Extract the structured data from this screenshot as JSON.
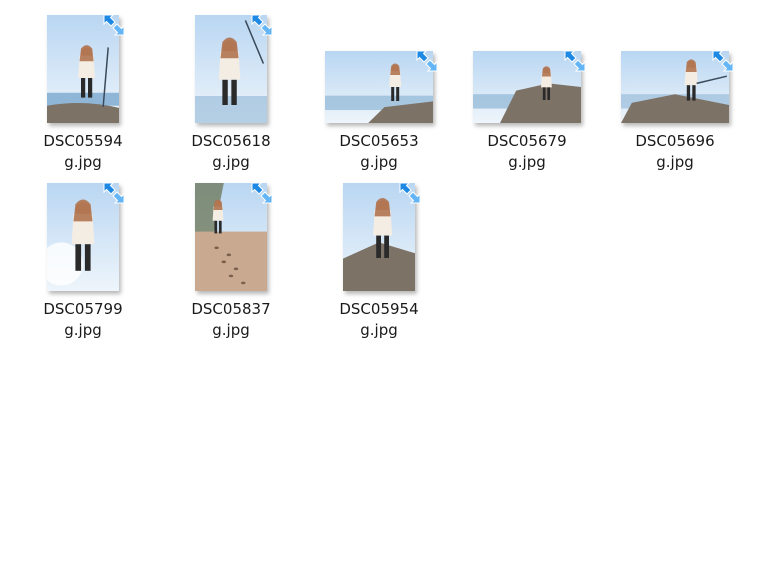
{
  "files": [
    {
      "line1": "DSC05594",
      "line2": "g.jpg",
      "orientation": "portrait",
      "scene": "standing-shore"
    },
    {
      "line1": "DSC05618",
      "line2": "g.jpg",
      "orientation": "portrait",
      "scene": "pose-sky"
    },
    {
      "line1": "DSC05653",
      "line2": "g.jpg",
      "orientation": "landscape",
      "scene": "standing-rock-far"
    },
    {
      "line1": "DSC05679",
      "line2": "g.jpg",
      "orientation": "landscape",
      "scene": "sitting-rock"
    },
    {
      "line1": "DSC05696",
      "line2": "g.jpg",
      "orientation": "landscape",
      "scene": "sitting-rock-sword"
    },
    {
      "line1": "DSC05799",
      "line2": "g.jpg",
      "orientation": "portrait",
      "scene": "backlit-sky"
    },
    {
      "line1": "DSC05837",
      "line2": "g.jpg",
      "orientation": "portrait",
      "scene": "footprints-beach"
    },
    {
      "line1": "DSC05954",
      "line2": "g.jpg",
      "orientation": "portrait",
      "scene": "kneeling-rock"
    }
  ],
  "overlay_icon": "shortcut-arrow-icon",
  "colors": {
    "arrow": "#1e88e5",
    "arrow_light": "#64b5f6",
    "sky": "#cfe3f7",
    "sea": "#8fb6d6",
    "rock": "#7d7266",
    "sand": "#c9a98f"
  }
}
